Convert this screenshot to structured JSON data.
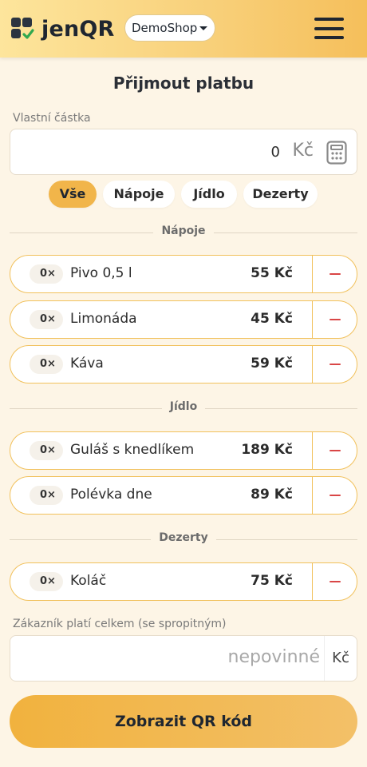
{
  "header": {
    "brand": "jenQR",
    "shop_select": "DemoShop"
  },
  "page": {
    "title": "Přijmout platbu"
  },
  "custom_amount": {
    "label": "Vlastní částka",
    "value": "0",
    "unit": "Kč"
  },
  "filters": [
    "Vše",
    "Nápoje",
    "Jídlo",
    "Dezerty"
  ],
  "filter_active": "Vše",
  "sections": [
    {
      "title": "Nápoje",
      "items": [
        {
          "qty": "0×",
          "name": "Pivo 0,5 l",
          "price": "55 Kč"
        },
        {
          "qty": "0×",
          "name": "Limonáda",
          "price": "45 Kč"
        },
        {
          "qty": "0×",
          "name": "Káva",
          "price": "59 Kč"
        }
      ]
    },
    {
      "title": "Jídlo",
      "items": [
        {
          "qty": "0×",
          "name": "Guláš s knedlíkem",
          "price": "189 Kč"
        },
        {
          "qty": "0×",
          "name": "Polévka dne",
          "price": "89 Kč"
        }
      ]
    },
    {
      "title": "Dezerty",
      "items": [
        {
          "qty": "0×",
          "name": "Koláč",
          "price": "75 Kč"
        }
      ]
    }
  ],
  "total": {
    "label": "Zákazník platí celkem (se spropitným)",
    "placeholder": "nepovinné",
    "unit": "Kč"
  },
  "submit_label": "Zobrazit QR kód",
  "colors": {
    "accent": "#f1b54a",
    "item_border": "#f1c15c",
    "minus": "#d94646",
    "background": "#fdf5e6"
  }
}
